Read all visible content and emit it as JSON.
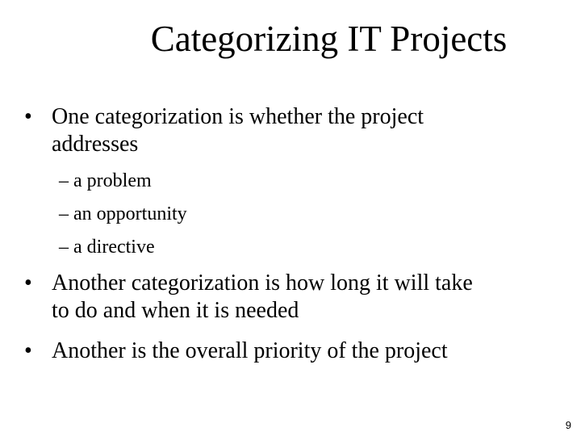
{
  "slide": {
    "title": "Categorizing IT Projects",
    "bullet_glyph": "•",
    "sub_glyph": "–",
    "bullets": [
      {
        "lines": [
          "One categorization is whether the project",
          "addresses"
        ],
        "subitems": [
          "a problem",
          "an opportunity",
          "a directive"
        ]
      },
      {
        "lines": [
          "Another categorization is how long it will take",
          "to do and when it is needed"
        ],
        "subitems": []
      },
      {
        "lines": [
          "Another is the overall priority of the project"
        ],
        "subitems": []
      }
    ],
    "page_number": "9"
  }
}
